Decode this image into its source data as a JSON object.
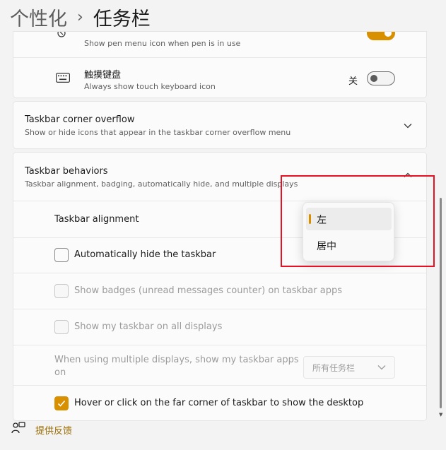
{
  "breadcrumb": {
    "parent": "个性化",
    "separator": "›",
    "current": "任务栏"
  },
  "pen_menu": {
    "subtitle": "Show pen menu icon when pen is in use",
    "state": "on"
  },
  "touch_keyboard": {
    "title": "触摸键盘",
    "subtitle": "Always show touch keyboard icon",
    "state_label": "关"
  },
  "corner_overflow": {
    "title": "Taskbar corner overflow",
    "subtitle": "Show or hide icons that appear in the taskbar corner overflow menu"
  },
  "behaviors": {
    "title": "Taskbar behaviors",
    "subtitle": "Taskbar alignment, badging, automatically hide, and multiple displays",
    "alignment_label": "Taskbar alignment",
    "auto_hide": {
      "label": "Automatically hide the taskbar",
      "checked": false
    },
    "badges": {
      "label": "Show badges (unread messages counter) on taskbar apps",
      "checked": false,
      "disabled": true
    },
    "all_displays": {
      "label": "Show my taskbar on all displays",
      "checked": false,
      "disabled": true
    },
    "multi_display": {
      "label_line1": "When using multiple displays, show my taskbar apps",
      "label_line2": "on",
      "dropdown_value": "所有任务栏"
    },
    "far_corner": {
      "label": "Hover or click on the far corner of taskbar to show the desktop",
      "checked": true
    }
  },
  "alignment_flyout": {
    "options": [
      "左",
      "居中"
    ],
    "selected_index": 0
  },
  "feedback": {
    "label": "提供反馈"
  },
  "colors": {
    "accent": "#d89000",
    "highlight_box": "#e81123"
  }
}
